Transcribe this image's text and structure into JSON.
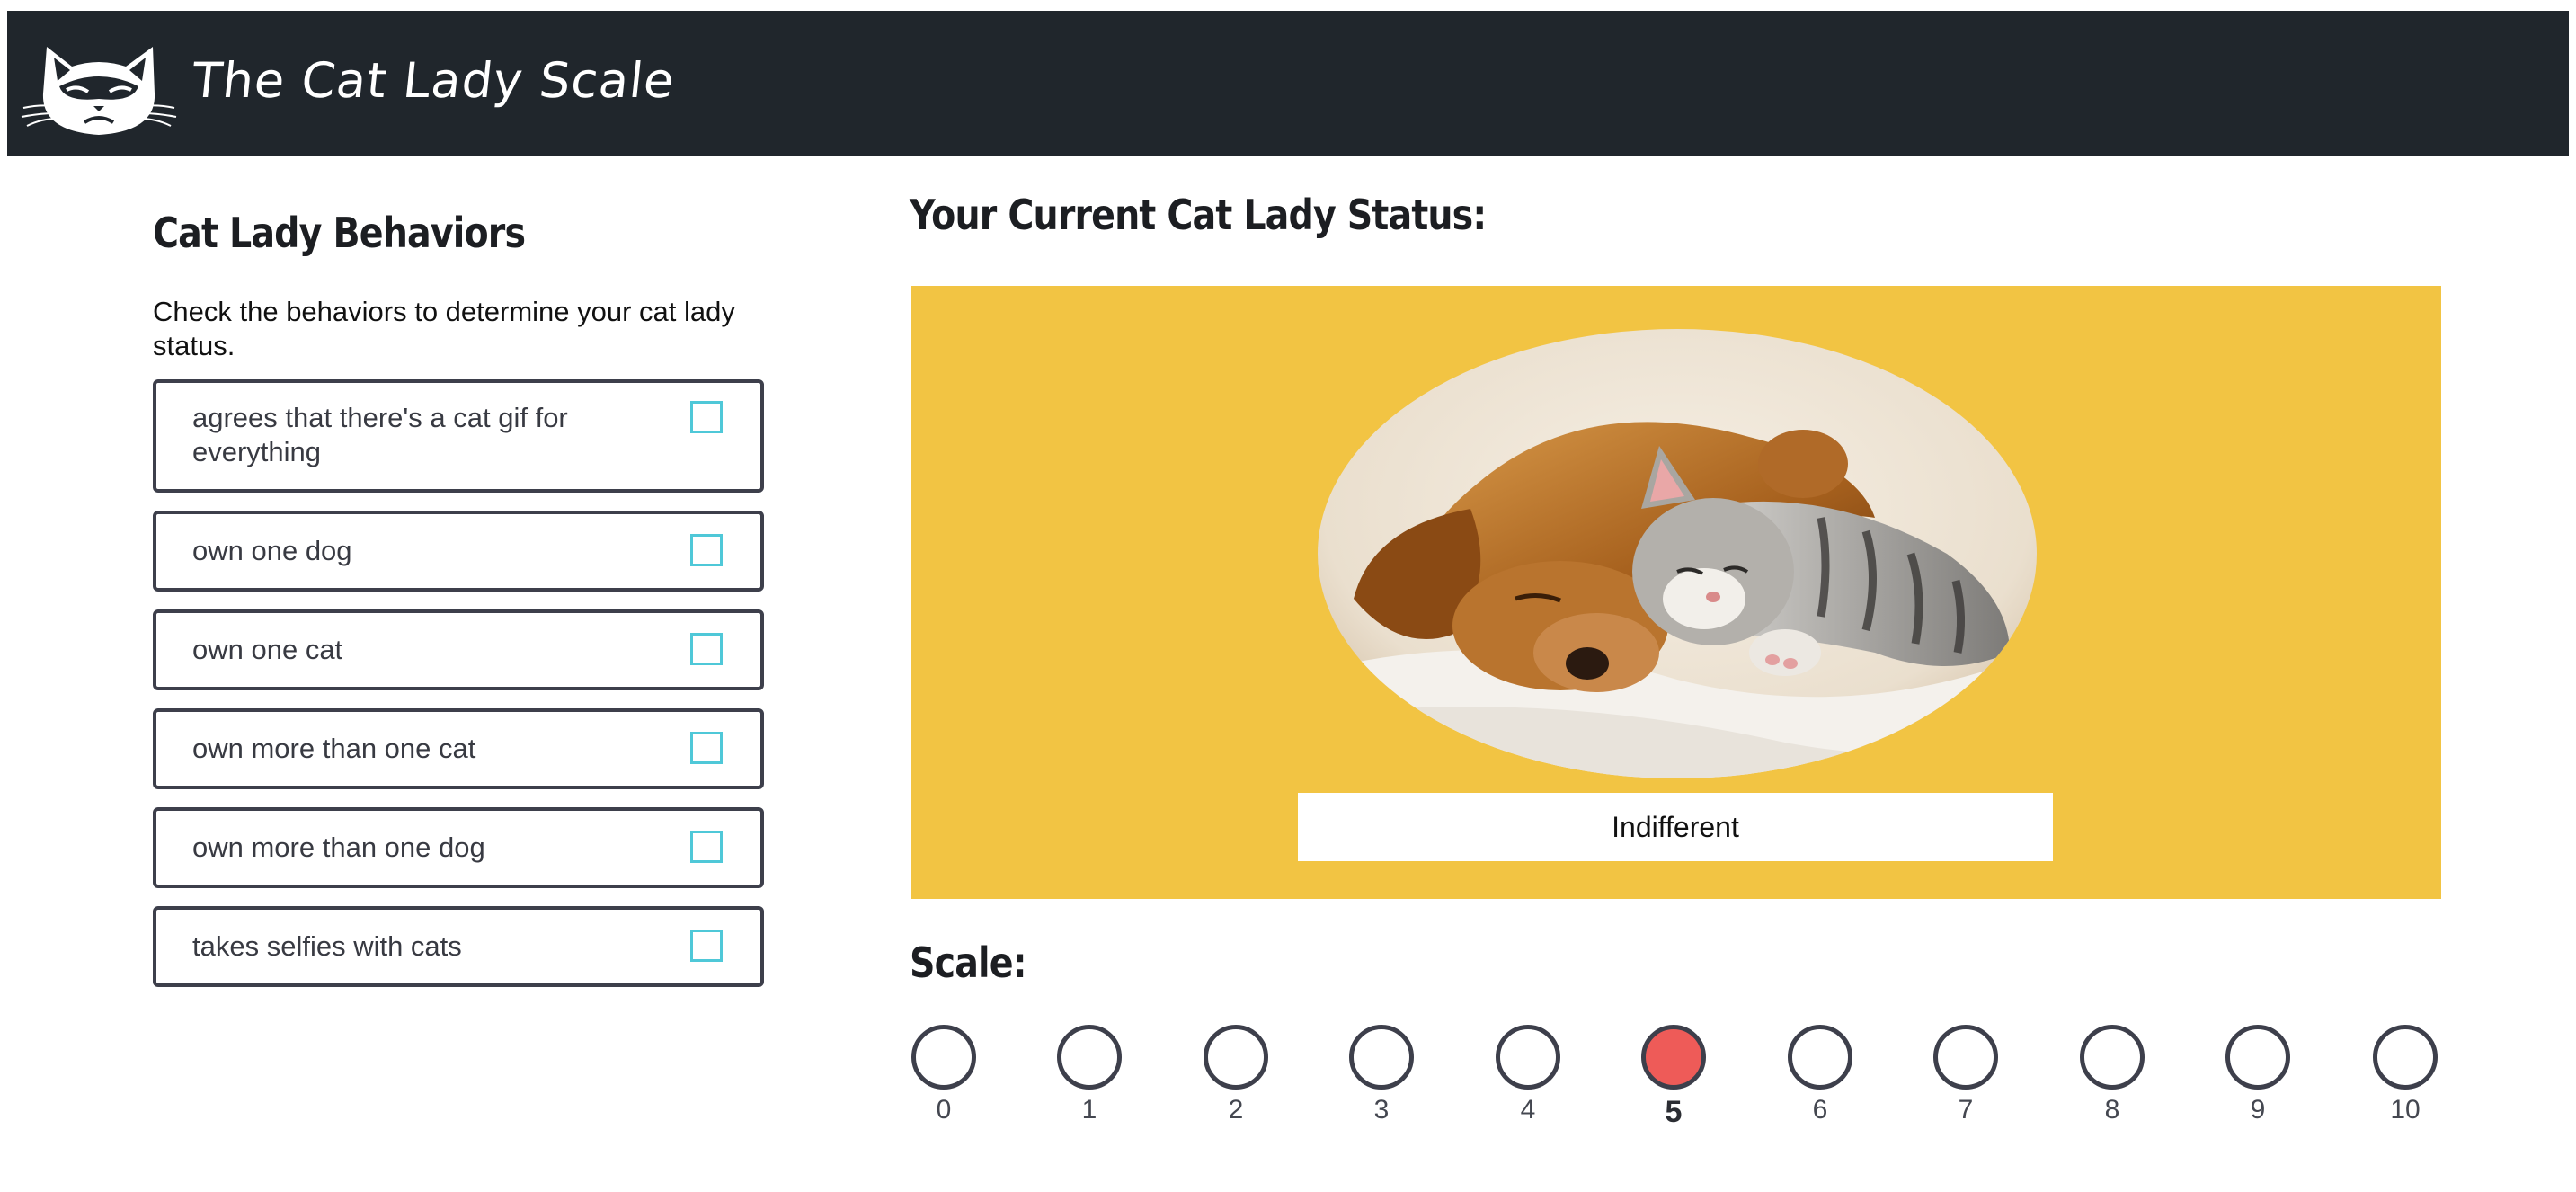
{
  "header": {
    "title": "The Cat Lady Scale",
    "logo": "grumpy-cat-logo",
    "background": "#20262c"
  },
  "behaviors": {
    "title": "Cat Lady Behaviors",
    "intro": "Check the behaviors to determine your cat lady status.",
    "items": [
      {
        "label": "agrees that there's a cat gif for everything",
        "checked": false
      },
      {
        "label": "own one dog",
        "checked": false
      },
      {
        "label": "own one cat",
        "checked": false
      },
      {
        "label": "own more than one cat",
        "checked": false
      },
      {
        "label": "own more than one dog",
        "checked": false
      },
      {
        "label": "takes selfies with cats",
        "checked": false
      }
    ],
    "checkbox_color": "#4fc8d8"
  },
  "status": {
    "title": "Your Current Cat Lady Status:",
    "label": "Indifferent",
    "panel_color": "#f2c443",
    "image": "puppy-and-kitten-sleeping"
  },
  "scale": {
    "title": "Scale:",
    "values": [
      "0",
      "1",
      "2",
      "3",
      "4",
      "5",
      "6",
      "7",
      "8",
      "9",
      "10"
    ],
    "selected": "5",
    "active_color": "#ee5b58"
  }
}
